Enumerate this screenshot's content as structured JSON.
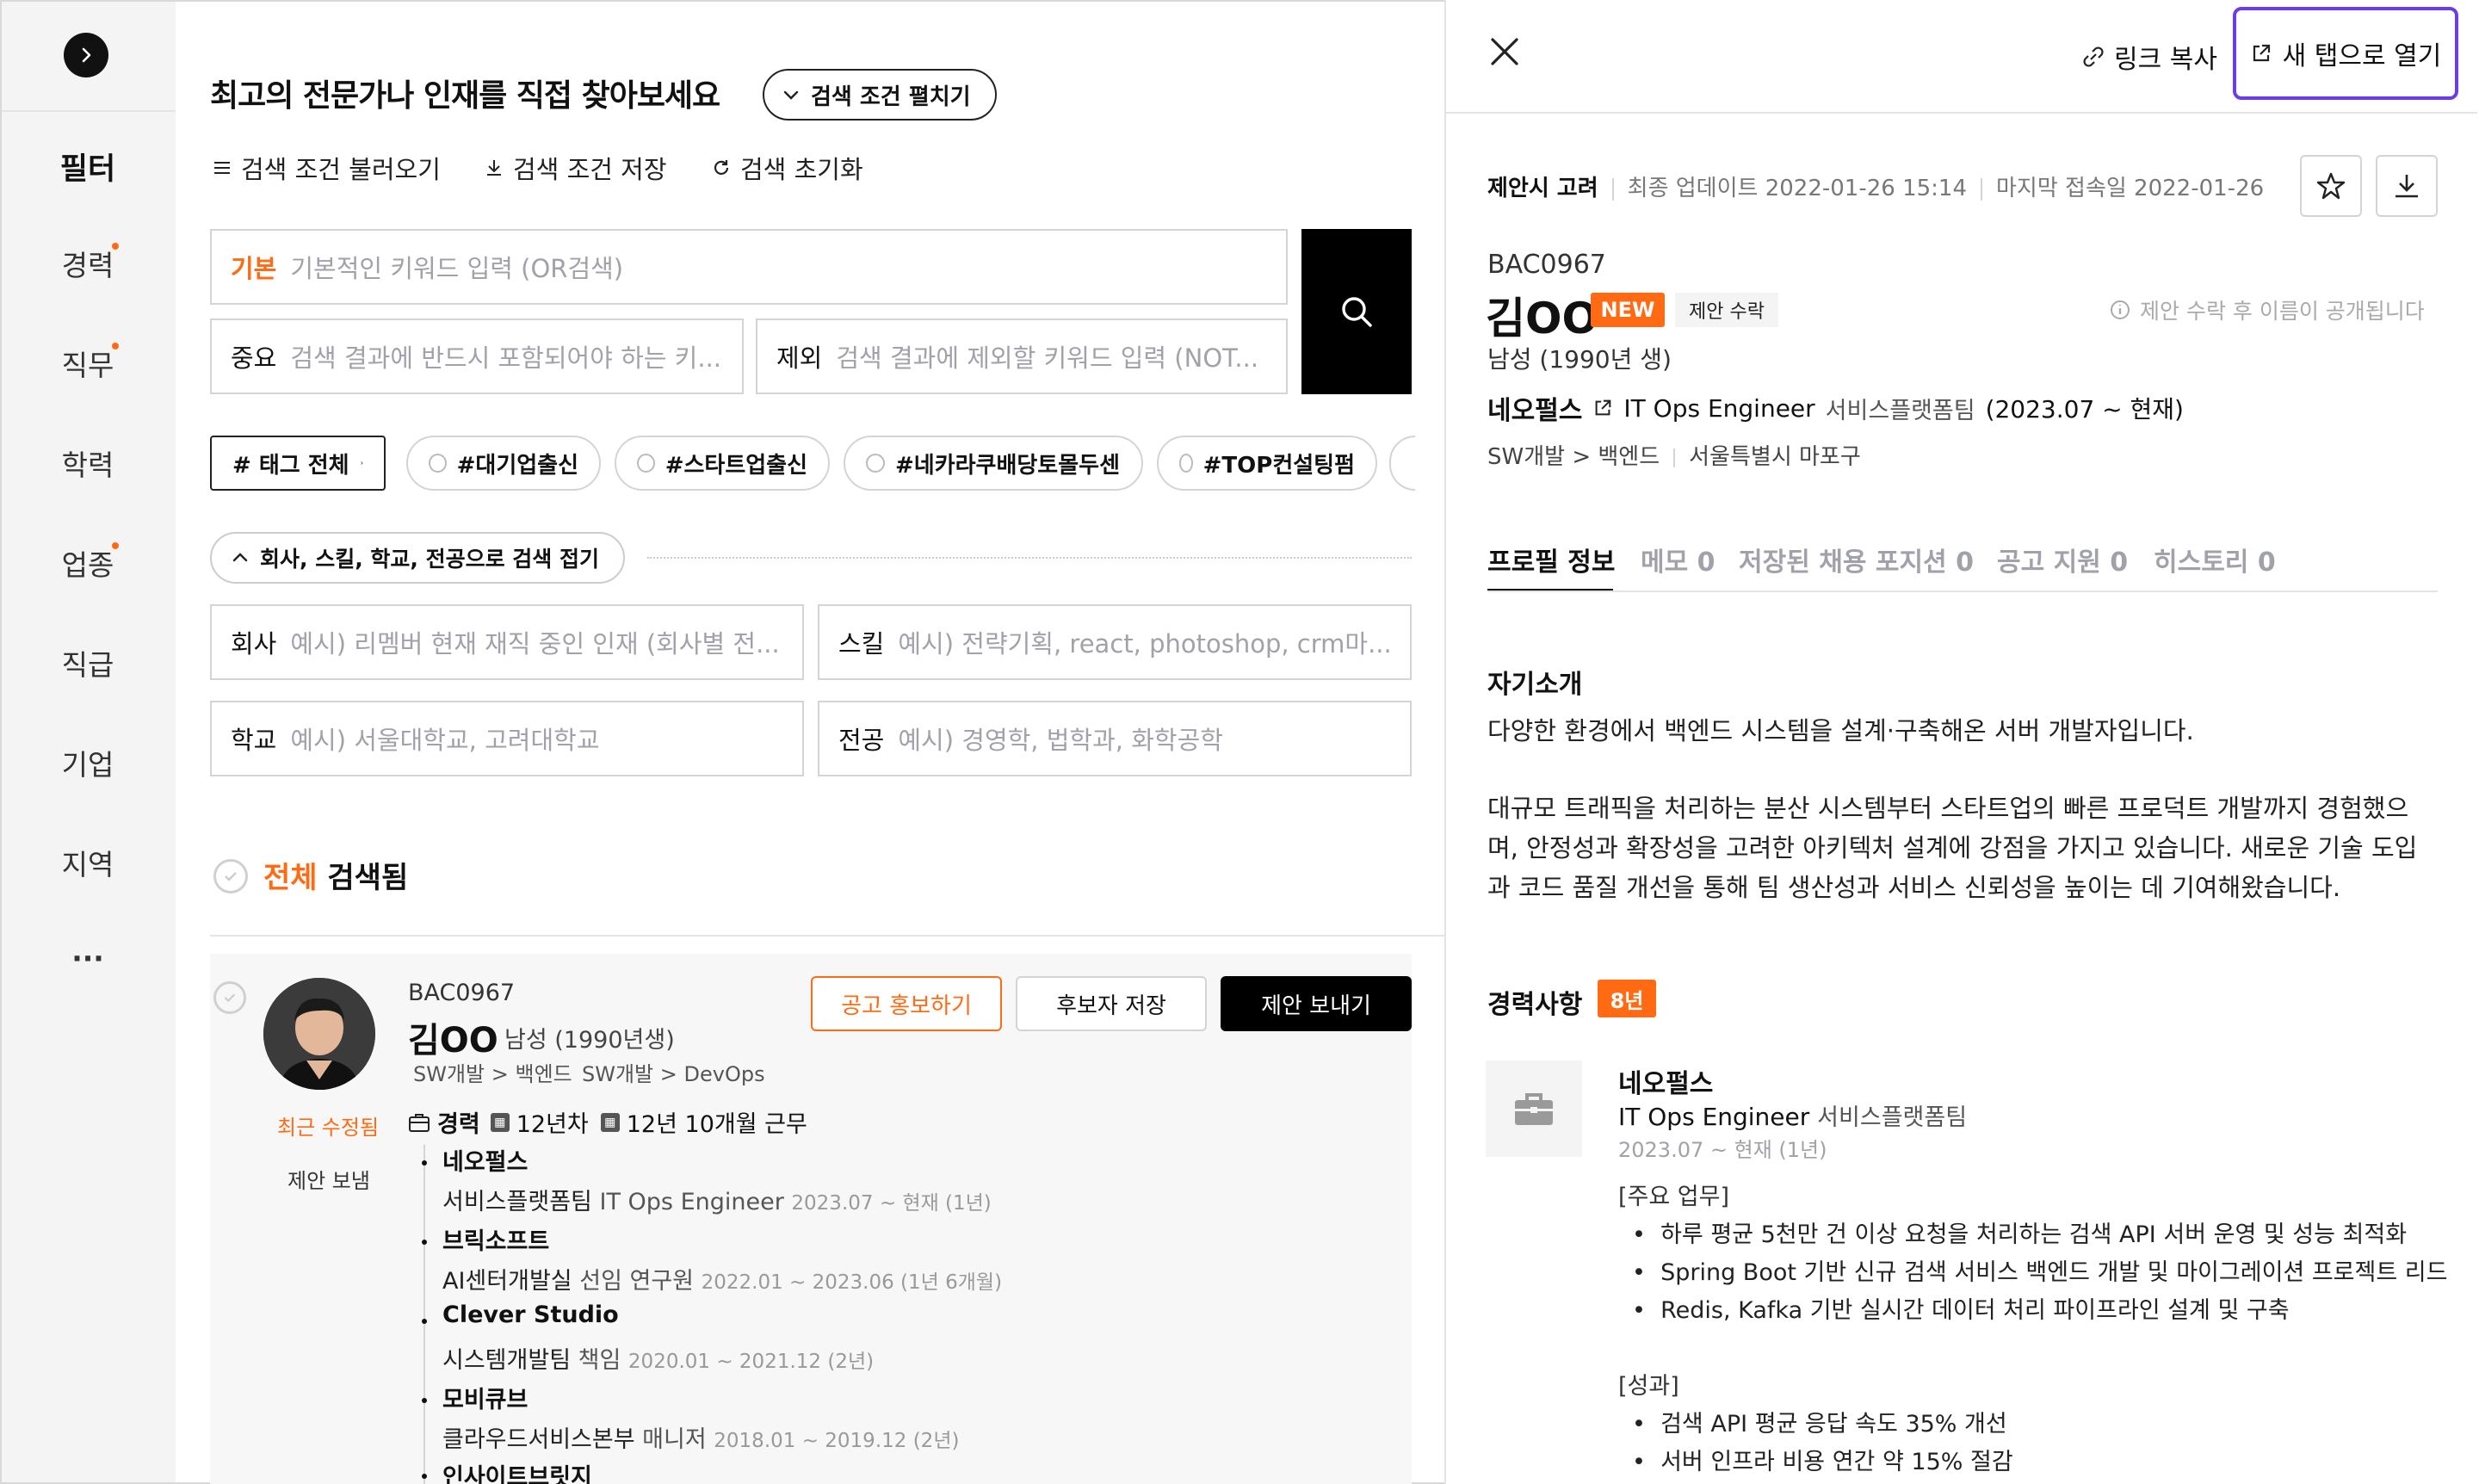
{
  "sidebar": {
    "title": "필터",
    "items": [
      {
        "label": "경력",
        "dot": true
      },
      {
        "label": "직무",
        "dot": true
      },
      {
        "label": "학력",
        "dot": false
      },
      {
        "label": "업종",
        "dot": true
      },
      {
        "label": "직급",
        "dot": false
      },
      {
        "label": "기업",
        "dot": false
      },
      {
        "label": "지역",
        "dot": false
      }
    ],
    "more": "···"
  },
  "search": {
    "heading": "최고의 전문가나 인재를 직접 찾아보세요",
    "expand_label": "검색 조건 펼치기",
    "actions": [
      "검색 조건 불러오기",
      "검색 조건 저장",
      "검색 초기화"
    ],
    "basic": {
      "label": "기본",
      "placeholder": "기본적인 키워드 입력 (OR검색)"
    },
    "required": {
      "label": "중요",
      "placeholder": "검색 결과에 반드시 포함되어야 하는 키..."
    },
    "exclude": {
      "label": "제외",
      "placeholder": "검색 결과에 제외할 키워드 입력 (NOT..."
    },
    "tags_all": "# 태그 전체",
    "tags": [
      "#대기업출신",
      "#스타트업출신",
      "#네카라쿠배당토몰두센",
      "#TOP컨설팅펌"
    ],
    "collapse_label": "회사, 스킬, 학교, 전공으로 검색 접기",
    "company": {
      "label": "회사",
      "placeholder": "예시) 리멤버 현재 재직 중인 인재 (회사별 전..."
    },
    "skill": {
      "label": "스킬",
      "placeholder": "예시) 전략기획, react, photoshop, crm마..."
    },
    "school": {
      "label": "학교",
      "placeholder": "예시) 서울대학교, 고려대학교"
    },
    "major": {
      "label": "전공",
      "placeholder": "예시) 경영학, 법학과, 화학공학"
    }
  },
  "results": {
    "title_accent": "전체",
    "title_rest": "검색됨",
    "card": {
      "id": "BAC0967",
      "name": "김OO",
      "gender_age": "남성 (1990년생)",
      "jobs": [
        "SW개발 > 백엔드",
        "SW개발 > DevOps"
      ],
      "recent_label": "최근 수정됨",
      "sent_label": "제안 보냄",
      "btn_promote": "공고 홍보하기",
      "btn_save": "후보자 저장",
      "btn_send": "제안 보내기",
      "career_label": "경력",
      "career_years": "12년차",
      "career_total": "12년 10개월 근무",
      "history": [
        {
          "company": "네오펄스",
          "dept": "서비스플랫폼팀",
          "role": "IT Ops Engineer",
          "period": "2023.07 ~ 현재 (1년)"
        },
        {
          "company": "브릭소프트",
          "dept": "AI센터개발실",
          "role": "선임 연구원",
          "period": "2022.01 ~ 2023.06 (1년 6개월)"
        },
        {
          "company": "Clever Studio",
          "dept": "시스템개발팀",
          "role": "책임",
          "period": "2020.01 ~ 2021.12 (2년)"
        },
        {
          "company": "모비큐브",
          "dept": "클라우드서비스본부",
          "role": "매니저",
          "period": "2018.01 ~ 2019.12 (2년)"
        },
        {
          "company": "인사이트브릿지",
          "dept": "",
          "role": "",
          "period": ""
        }
      ]
    }
  },
  "panel": {
    "copy_link": "링크 복사",
    "open_new_tab": "새 탭으로 열기",
    "status": "제안시 고려",
    "updated": "최종 업데이트 2022-01-26 15:14",
    "last_login": "마지막 접속일 2022-01-26",
    "id": "BAC0967",
    "name": "김OO",
    "badge_new": "NEW",
    "badge_accept": "제안 수락",
    "name_notice": "제안 수락 후 이름이 공개됩니다",
    "gender_age": "남성 (1990년 생)",
    "company": "네오펄스",
    "role": "IT Ops Engineer",
    "dept": "서비스플랫폼팀",
    "period": "(2023.07 ~ 현재)",
    "job": "SW개발 > 백엔드",
    "location": "서울특별시 마포구",
    "tabs": [
      "프로필 정보",
      "메모 0",
      "저장된 채용 포지션 0",
      "공고 지원 0",
      "히스토리 0"
    ],
    "intro_title": "자기소개",
    "intro_p1": "다양한 환경에서 백엔드 시스템을 설계·구축해온 서버 개발자입니다.",
    "intro_p2": "대규모 트래픽을 처리하는 분산 시스템부터 스타트업의 빠른 프로덕트 개발까지 경험했으며, 안정성과 확장성을 고려한 아키텍처 설계에 강점을 가지고 있습니다. 새로운 기술 도입과 코드 품질 개선을 통해 팀 생산성과 서비스 신뢰성을 높이는 데 기여해왔습니다.",
    "career_title": "경력사항",
    "career_badge": "8년",
    "exp": {
      "company": "네오펄스",
      "role": "IT Ops Engineer",
      "dept": "서비스플랫폼팀",
      "period": "2023.07 ~ 현재 (1년)",
      "duties_title": "[주요 업무]",
      "duties": [
        "하루 평균 5천만 건 이상 요청을 처리하는 검색 API 서버 운영 및 성능 최적화",
        "Spring Boot 기반 신규 검색 서비스 백엔드 개발 및 마이그레이션 프로젝트 리드",
        "Redis, Kafka 기반 실시간 데이터 처리 파이프라인 설계 및 구축"
      ],
      "results_title": "[성과]",
      "results": [
        "검색 API 평균 응답 속도 35% 개선",
        "서버 인프라 비용 연간 약 15% 절감"
      ]
    }
  },
  "colors": {
    "accent": "#ff6a13",
    "focus": "#6c3ce9"
  }
}
